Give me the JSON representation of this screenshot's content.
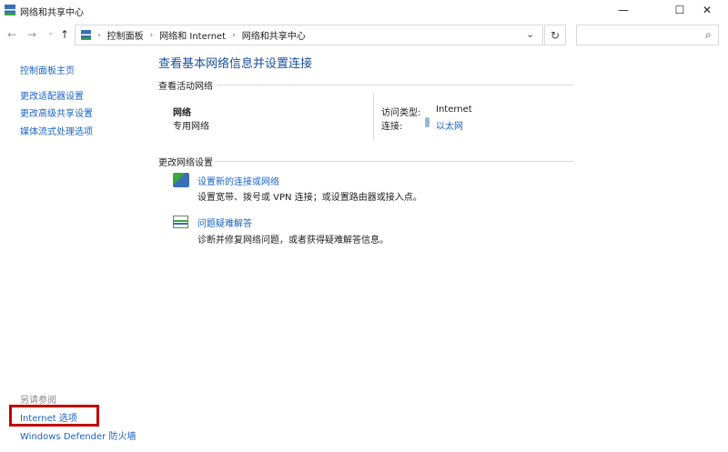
{
  "window": {
    "title": "网络和共享中心",
    "minimize": "—",
    "maximize": "☐",
    "close": "✕"
  },
  "nav": {
    "back": "←",
    "forward": "→",
    "recent": "⌄",
    "up": "↑",
    "breadcrumb": [
      "控制面板",
      "网络和 Internet",
      "网络和共享中心"
    ],
    "dropdown": "⌄",
    "refresh": "↻",
    "search_placeholder": "",
    "search_icon": "⌕"
  },
  "sidebar": {
    "items": [
      {
        "label": "控制面板主页"
      },
      {
        "label": "更改适配器设置"
      },
      {
        "label": "更改高级共享设置"
      },
      {
        "label": "媒体流式处理选项"
      }
    ],
    "see_also": "另请参阅",
    "see_also_items": [
      {
        "label": "Internet 选项"
      },
      {
        "label": "Windows Defender 防火墙"
      }
    ],
    "highlight_color": "#c00000"
  },
  "main": {
    "heading": "查看基本网络信息并设置连接",
    "active_section": "查看活动网络",
    "network": {
      "name": "网络",
      "type": "专用网络",
      "access_label": "访问类型:",
      "access_value": "Internet",
      "conn_label": "连接:",
      "conn_value": "以太网"
    },
    "change_section": "更改网络设置",
    "tasks": [
      {
        "title": "设置新的连接或网络",
        "desc": "设置宽带、拨号或 VPN 连接；或设置路由器或接入点。",
        "icon": "network-setup-icon"
      },
      {
        "title": "问题疑难解答",
        "desc": "诊断并修复网络问题，或者获得疑难解答信息。",
        "icon": "troubleshoot-icon"
      }
    ]
  }
}
